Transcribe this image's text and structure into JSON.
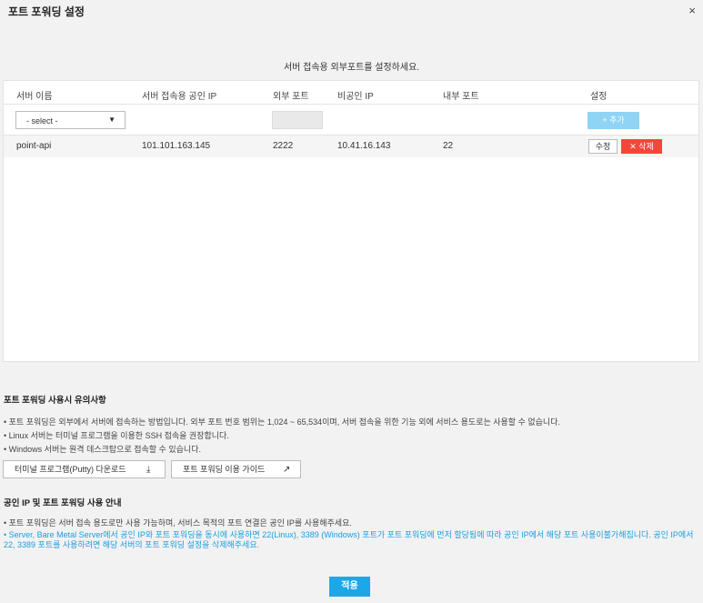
{
  "dialog": {
    "title": "포트 포워딩 설정",
    "close_icon": "×"
  },
  "subtitle": "서버 접속용 외부포트를 설정하세요.",
  "table": {
    "headers": [
      "서버 이름",
      "서버 접속용 공인 IP",
      "외부 포트",
      "비공인 IP",
      "내부 포트",
      "설정"
    ],
    "input_row": {
      "select_value": "- select -",
      "select_caret": "▼",
      "external_port_value": "",
      "add_label": "+ 추가"
    },
    "rows": [
      {
        "server_name": "point-api",
        "public_ip": "101.101.163.145",
        "external_port": "2222",
        "private_ip": "10.41.16.143",
        "internal_port": "22",
        "edit_label": "수정",
        "delete_label": "✕ 삭제"
      }
    ]
  },
  "notice1": {
    "title": "포트 포워딩 사용시 유의사항",
    "items": [
      "• 포트 포워딩은 외부에서 서버에 접속하는 방법입니다. 외부 포트 번호 범위는 1,024 ~ 65,534이며, 서버 접속을 위한 기능 외에 서비스 용도로는 사용할 수 없습니다.",
      "• Linux 서버는 터미널 프로그램을 이용한 SSH 접속을 권장합니다.",
      "• Windows 서버는 원격 데스크탑으로 접속할 수 있습니다."
    ],
    "putty_button": "터미널 프로그램(Putty) 다운로드",
    "guide_button": "포트 포워딩 이용 가이드",
    "download_icon": "⤓",
    "external_link_icon": "↗"
  },
  "notice2": {
    "title": "공인 IP 및 포트 포워딩 사용 안내",
    "items": [
      "• 포트 포워딩은 서버 접속 용도로만 사용 가능하며, 서비스 목적의 포트 연결은 공인 IP를 사용해주세요.",
      "• Server, Bare Metal Server에서 공인 IP와 포트 포워딩을 동시에 사용하면 22(Linux), 3389 (Windows) 포트가 포트 포워딩에 먼저 할당됨에 따라 공인 IP에서 해당 포트 사용이불가해집니다. 공인 IP에서 22, 3389 포트를 사용하려면 해당 서버의 포트 포워딩 설정을 삭제해주세요."
    ]
  },
  "apply_label": "적용",
  "colors": {
    "accent": "#1ea7e8",
    "danger": "#f4473a",
    "info_text": "#1a9de0"
  }
}
